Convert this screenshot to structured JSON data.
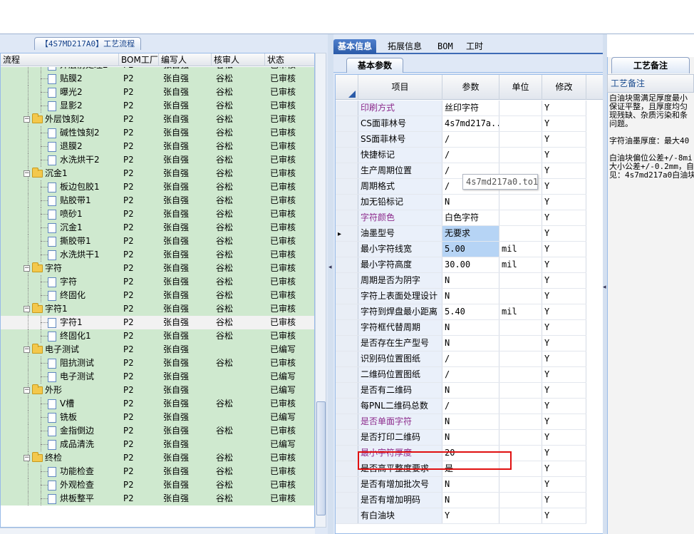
{
  "left_panel": {
    "tab_label": "【4S7MD217A0】工艺流程",
    "columns": [
      "流程",
      "BOM工厂",
      "编写人",
      "核审人",
      "状态"
    ],
    "rows": [
      {
        "name": "外层前处理2",
        "level": 2,
        "kind": "doc",
        "bom": "P2",
        "author": "张自强",
        "reviewer": "谷松",
        "status": "已审核"
      },
      {
        "name": "贴膜2",
        "level": 2,
        "kind": "doc",
        "bom": "P2",
        "author": "张自强",
        "reviewer": "谷松",
        "status": "已审核"
      },
      {
        "name": "曝光2",
        "level": 2,
        "kind": "doc",
        "bom": "P2",
        "author": "张自强",
        "reviewer": "谷松",
        "status": "已审核"
      },
      {
        "name": "显影2",
        "level": 2,
        "kind": "doc",
        "bom": "P2",
        "author": "张自强",
        "reviewer": "谷松",
        "status": "已审核"
      },
      {
        "name": "外层蚀刻2",
        "level": 1,
        "kind": "folder",
        "bom": "P2",
        "author": "张自强",
        "reviewer": "谷松",
        "status": "已审核"
      },
      {
        "name": "碱性蚀刻2",
        "level": 2,
        "kind": "doc",
        "bom": "P2",
        "author": "张自强",
        "reviewer": "谷松",
        "status": "已审核"
      },
      {
        "name": "退膜2",
        "level": 2,
        "kind": "doc",
        "bom": "P2",
        "author": "张自强",
        "reviewer": "谷松",
        "status": "已审核"
      },
      {
        "name": "水洗烘干2",
        "level": 2,
        "kind": "doc",
        "bom": "P2",
        "author": "张自强",
        "reviewer": "谷松",
        "status": "已审核"
      },
      {
        "name": "沉金1",
        "level": 1,
        "kind": "folder",
        "bom": "P2",
        "author": "张自强",
        "reviewer": "谷松",
        "status": "已审核"
      },
      {
        "name": "板边包胶1",
        "level": 2,
        "kind": "doc",
        "bom": "P2",
        "author": "张自强",
        "reviewer": "谷松",
        "status": "已审核"
      },
      {
        "name": "贴胶带1",
        "level": 2,
        "kind": "doc",
        "bom": "P2",
        "author": "张自强",
        "reviewer": "谷松",
        "status": "已审核"
      },
      {
        "name": "喷砂1",
        "level": 2,
        "kind": "doc",
        "bom": "P2",
        "author": "张自强",
        "reviewer": "谷松",
        "status": "已审核"
      },
      {
        "name": "沉金1",
        "level": 2,
        "kind": "doc",
        "bom": "P2",
        "author": "张自强",
        "reviewer": "谷松",
        "status": "已审核"
      },
      {
        "name": "撕胶带1",
        "level": 2,
        "kind": "doc",
        "bom": "P2",
        "author": "张自强",
        "reviewer": "谷松",
        "status": "已审核"
      },
      {
        "name": "水洗烘干1",
        "level": 2,
        "kind": "doc",
        "bom": "P2",
        "author": "张自强",
        "reviewer": "谷松",
        "status": "已审核"
      },
      {
        "name": "字符",
        "level": 1,
        "kind": "folder",
        "bom": "P2",
        "author": "张自强",
        "reviewer": "谷松",
        "status": "已审核"
      },
      {
        "name": "字符",
        "level": 2,
        "kind": "doc",
        "bom": "P2",
        "author": "张自强",
        "reviewer": "谷松",
        "status": "已审核"
      },
      {
        "name": "终固化",
        "level": 2,
        "kind": "doc",
        "bom": "P2",
        "author": "张自强",
        "reviewer": "谷松",
        "status": "已审核"
      },
      {
        "name": "字符1",
        "level": 1,
        "kind": "folder",
        "bom": "P2",
        "author": "张自强",
        "reviewer": "谷松",
        "status": "已审核"
      },
      {
        "name": "字符1",
        "level": 2,
        "kind": "doc",
        "bom": "P2",
        "author": "张自强",
        "reviewer": "谷松",
        "status": "已审核",
        "selected": true
      },
      {
        "name": "终固化1",
        "level": 2,
        "kind": "doc",
        "bom": "P2",
        "author": "张自强",
        "reviewer": "谷松",
        "status": "已审核"
      },
      {
        "name": "电子测试",
        "level": 1,
        "kind": "folder",
        "bom": "P2",
        "author": "张自强",
        "reviewer": "",
        "status": "已编写"
      },
      {
        "name": "阻抗测试",
        "level": 2,
        "kind": "doc",
        "bom": "P2",
        "author": "张自强",
        "reviewer": "谷松",
        "status": "已审核"
      },
      {
        "name": "电子测试",
        "level": 2,
        "kind": "doc",
        "bom": "P2",
        "author": "张自强",
        "reviewer": "",
        "status": "已编写"
      },
      {
        "name": "外形",
        "level": 1,
        "kind": "folder",
        "bom": "P2",
        "author": "张自强",
        "reviewer": "",
        "status": "已编写"
      },
      {
        "name": "V槽",
        "level": 2,
        "kind": "doc",
        "bom": "P2",
        "author": "张自强",
        "reviewer": "谷松",
        "status": "已审核"
      },
      {
        "name": "铣板",
        "level": 2,
        "kind": "doc",
        "bom": "P2",
        "author": "张自强",
        "reviewer": "",
        "status": "已编写"
      },
      {
        "name": "金指倒边",
        "level": 2,
        "kind": "doc",
        "bom": "P2",
        "author": "张自强",
        "reviewer": "谷松",
        "status": "已审核"
      },
      {
        "name": "成品清洗",
        "level": 2,
        "kind": "doc",
        "bom": "P2",
        "author": "张自强",
        "reviewer": "",
        "status": "已编写"
      },
      {
        "name": "终检",
        "level": 1,
        "kind": "folder",
        "bom": "P2",
        "author": "张自强",
        "reviewer": "谷松",
        "status": "已审核"
      },
      {
        "name": "功能检查",
        "level": 2,
        "kind": "doc",
        "bom": "P2",
        "author": "张自强",
        "reviewer": "谷松",
        "status": "已审核"
      },
      {
        "name": "外观检查",
        "level": 2,
        "kind": "doc",
        "bom": "P2",
        "author": "张自强",
        "reviewer": "谷松",
        "status": "已审核"
      },
      {
        "name": "烘板整平",
        "level": 2,
        "kind": "doc",
        "bom": "P2",
        "author": "张自强",
        "reviewer": "谷松",
        "status": "已审核"
      }
    ]
  },
  "main_tabs": [
    "基本信息",
    "拓展信息",
    "BOM",
    "工时"
  ],
  "active_main_tab": 0,
  "sub_tab": "基本参数",
  "prop_grid": {
    "columns": [
      "项目",
      "参数",
      "单位",
      "修改"
    ],
    "rows": [
      {
        "item": "印刷方式",
        "value": "丝印字符",
        "unit": "",
        "mod": "Y",
        "purple": true
      },
      {
        "item": "CS面菲林号",
        "value": "4s7md217a...",
        "unit": "",
        "mod": "Y"
      },
      {
        "item": "SS面菲林号",
        "value": "/",
        "unit": "",
        "mod": "Y"
      },
      {
        "item": "快捷标记",
        "value": "/",
        "unit": "",
        "mod": "Y"
      },
      {
        "item": "生产周期位置",
        "value": "/",
        "unit": "",
        "mod": "Y"
      },
      {
        "item": "周期格式",
        "value": "/",
        "unit": "",
        "mod": "Y"
      },
      {
        "item": "加无铅标记",
        "value": "N",
        "unit": "",
        "mod": "Y"
      },
      {
        "item": "字符颜色",
        "value": "白色字符",
        "unit": "",
        "mod": "Y",
        "purple": true
      },
      {
        "item": "油墨型号",
        "value": "无要求",
        "unit": "",
        "mod": "Y",
        "current": true
      },
      {
        "item": "最小字符线宽",
        "value": "5.00",
        "unit": "mil",
        "mod": "Y",
        "editing": true
      },
      {
        "item": "最小字符高度",
        "value": "30.00",
        "unit": "mil",
        "mod": "Y"
      },
      {
        "item": "周期是否为阴字",
        "value": "N",
        "unit": "",
        "mod": "Y"
      },
      {
        "item": "字符上表面处理设计",
        "value": "N",
        "unit": "",
        "mod": "Y"
      },
      {
        "item": "字符到焊盘最小距离",
        "value": "5.40",
        "unit": "mil",
        "mod": "Y"
      },
      {
        "item": "字符框代替周期",
        "value": "N",
        "unit": "",
        "mod": "Y"
      },
      {
        "item": "是否存在生产型号",
        "value": "N",
        "unit": "",
        "mod": "Y"
      },
      {
        "item": "识别码位置图纸",
        "value": "/",
        "unit": "",
        "mod": "Y"
      },
      {
        "item": "二维码位置图纸",
        "value": "/",
        "unit": "",
        "mod": "Y"
      },
      {
        "item": "是否有二维码",
        "value": "N",
        "unit": "",
        "mod": "Y"
      },
      {
        "item": "每PNL二维码总数",
        "value": "/",
        "unit": "",
        "mod": "Y"
      },
      {
        "item": "是否单面字符",
        "value": "N",
        "unit": "",
        "mod": "Y",
        "purple": true
      },
      {
        "item": "是否打印二维码",
        "value": "N",
        "unit": "",
        "mod": "Y"
      },
      {
        "item": "最小字符厚度",
        "value": "20",
        "unit": "",
        "mod": "Y",
        "purple": true
      },
      {
        "item": "是否高平整度要求",
        "value": "是",
        "unit": "",
        "mod": "Y"
      },
      {
        "item": "是否有增加批次号",
        "value": "N",
        "unit": "",
        "mod": "Y"
      },
      {
        "item": "是否有增加明码",
        "value": "N",
        "unit": "",
        "mod": "Y"
      },
      {
        "item": "有白油块",
        "value": "Y",
        "unit": "",
        "mod": "Y"
      }
    ],
    "tooltip": "4s7md217a0.to1"
  },
  "right_panel": {
    "tab_label": "工艺备注",
    "header": "工艺备注",
    "paragraphs": [
      [
        "白油块需满足厚度最小",
        "保证平整，且厚度均匀",
        "现残缺、杂质污染和条",
        "问题。"
      ],
      [
        "字符油墨厚度：最大40"
      ],
      [
        "白油块偏位公差+/-8mi",
        "大小公差+/-0.2mm，自",
        "见：4s7md217a0白油块"
      ]
    ]
  },
  "colors": {
    "purple_label": "#8c2a8c",
    "row_green": "#cfe9cf",
    "highlight": "#e01010",
    "tab_blue": "#2a5aa8"
  }
}
